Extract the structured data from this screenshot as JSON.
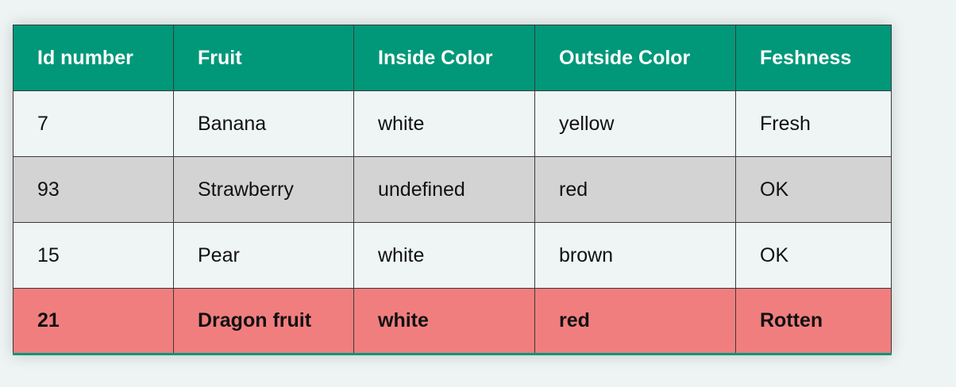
{
  "table": {
    "headers": [
      "Id number",
      "Fruit",
      "Inside Color",
      "Outside Color",
      "Feshness"
    ],
    "rows": [
      [
        "7",
        "Banana",
        "white",
        "yellow",
        "Fresh"
      ],
      [
        "93",
        "Strawberry",
        "undefined",
        "red",
        "OK"
      ],
      [
        "15",
        "Pear",
        "white",
        "brown",
        "OK"
      ],
      [
        "21",
        "Dragon fruit",
        "white",
        "red",
        "Rotten"
      ]
    ]
  },
  "colors": {
    "header_bg": "#009879",
    "row_light": "#eef5f4",
    "row_gray": "#d3d3d3",
    "row_highlight": "#f17e7e"
  }
}
